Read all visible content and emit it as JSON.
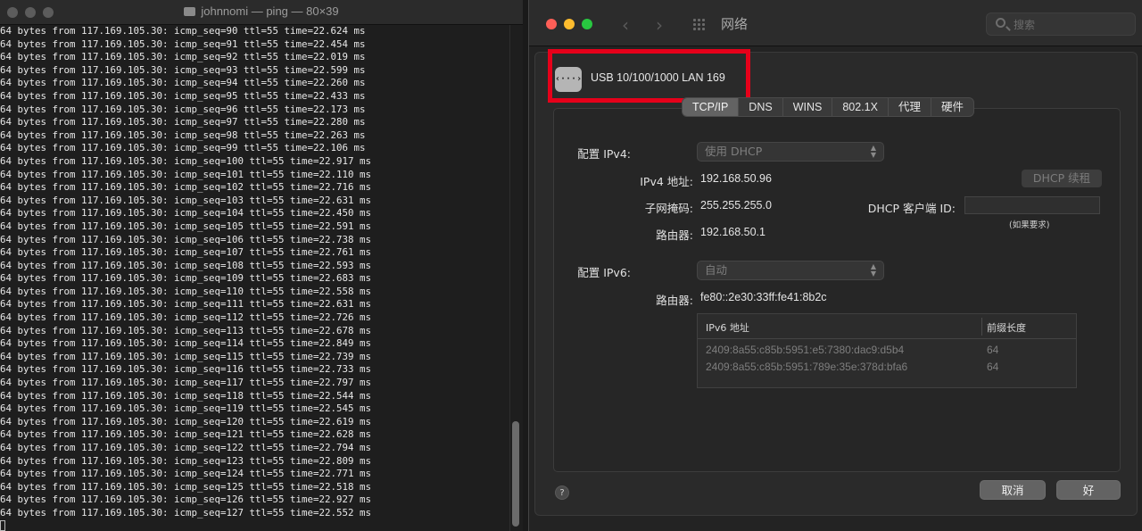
{
  "terminal": {
    "title": "johnnomi — ping — 80×39",
    "lines": [
      "64 bytes from 117.169.105.30: icmp_seq=90 ttl=55 time=22.624 ms",
      "64 bytes from 117.169.105.30: icmp_seq=91 ttl=55 time=22.454 ms",
      "64 bytes from 117.169.105.30: icmp_seq=92 ttl=55 time=22.019 ms",
      "64 bytes from 117.169.105.30: icmp_seq=93 ttl=55 time=22.599 ms",
      "64 bytes from 117.169.105.30: icmp_seq=94 ttl=55 time=22.260 ms",
      "64 bytes from 117.169.105.30: icmp_seq=95 ttl=55 time=22.433 ms",
      "64 bytes from 117.169.105.30: icmp_seq=96 ttl=55 time=22.173 ms",
      "64 bytes from 117.169.105.30: icmp_seq=97 ttl=55 time=22.280 ms",
      "64 bytes from 117.169.105.30: icmp_seq=98 ttl=55 time=22.263 ms",
      "64 bytes from 117.169.105.30: icmp_seq=99 ttl=55 time=22.106 ms",
      "64 bytes from 117.169.105.30: icmp_seq=100 ttl=55 time=22.917 ms",
      "64 bytes from 117.169.105.30: icmp_seq=101 ttl=55 time=22.110 ms",
      "64 bytes from 117.169.105.30: icmp_seq=102 ttl=55 time=22.716 ms",
      "64 bytes from 117.169.105.30: icmp_seq=103 ttl=55 time=22.631 ms",
      "64 bytes from 117.169.105.30: icmp_seq=104 ttl=55 time=22.450 ms",
      "64 bytes from 117.169.105.30: icmp_seq=105 ttl=55 time=22.591 ms",
      "64 bytes from 117.169.105.30: icmp_seq=106 ttl=55 time=22.738 ms",
      "64 bytes from 117.169.105.30: icmp_seq=107 ttl=55 time=22.761 ms",
      "64 bytes from 117.169.105.30: icmp_seq=108 ttl=55 time=22.593 ms",
      "64 bytes from 117.169.105.30: icmp_seq=109 ttl=55 time=22.683 ms",
      "64 bytes from 117.169.105.30: icmp_seq=110 ttl=55 time=22.558 ms",
      "64 bytes from 117.169.105.30: icmp_seq=111 ttl=55 time=22.631 ms",
      "64 bytes from 117.169.105.30: icmp_seq=112 ttl=55 time=22.726 ms",
      "64 bytes from 117.169.105.30: icmp_seq=113 ttl=55 time=22.678 ms",
      "64 bytes from 117.169.105.30: icmp_seq=114 ttl=55 time=22.849 ms",
      "64 bytes from 117.169.105.30: icmp_seq=115 ttl=55 time=22.739 ms",
      "64 bytes from 117.169.105.30: icmp_seq=116 ttl=55 time=22.733 ms",
      "64 bytes from 117.169.105.30: icmp_seq=117 ttl=55 time=22.797 ms",
      "64 bytes from 117.169.105.30: icmp_seq=118 ttl=55 time=22.544 ms",
      "64 bytes from 117.169.105.30: icmp_seq=119 ttl=55 time=22.545 ms",
      "64 bytes from 117.169.105.30: icmp_seq=120 ttl=55 time=22.619 ms",
      "64 bytes from 117.169.105.30: icmp_seq=121 ttl=55 time=22.628 ms",
      "64 bytes from 117.169.105.30: icmp_seq=122 ttl=55 time=22.794 ms",
      "64 bytes from 117.169.105.30: icmp_seq=123 ttl=55 time=22.809 ms",
      "64 bytes from 117.169.105.30: icmp_seq=124 ttl=55 time=22.771 ms",
      "64 bytes from 117.169.105.30: icmp_seq=125 ttl=55 time=22.518 ms",
      "64 bytes from 117.169.105.30: icmp_seq=126 ttl=55 time=22.927 ms",
      "64 bytes from 117.169.105.30: icmp_seq=127 ttl=55 time=22.552 ms"
    ]
  },
  "network": {
    "title": "网络",
    "search_placeholder": "搜索",
    "adapter_icon_text": "‹···›",
    "adapter_name": "USB 10/100/1000 LAN 169",
    "highlight_color": "#e6001a",
    "tabs": [
      {
        "label": "TCP/IP",
        "active": true
      },
      {
        "label": "DNS",
        "active": false
      },
      {
        "label": "WINS",
        "active": false
      },
      {
        "label": "802.1X",
        "active": false
      },
      {
        "label": "代理",
        "active": false
      },
      {
        "label": "硬件",
        "active": false
      }
    ],
    "configure_ipv4_label": "配置 IPv4:",
    "configure_ipv4_value": "使用 DHCP",
    "ipv4_address_label": "IPv4 地址:",
    "ipv4_address": "192.168.50.96",
    "renew_dhcp_label": "DHCP 续租",
    "subnet_mask_label": "子网掩码:",
    "subnet_mask": "255.255.255.0",
    "dhcp_client_id_label": "DHCP 客户端 ID:",
    "dhcp_client_id_hint": "(如果要求)",
    "router_label": "路由器:",
    "router": "192.168.50.1",
    "configure_ipv6_label": "配置 IPv6:",
    "configure_ipv6_value": "自动",
    "router6_label": "路由器:",
    "router6": "fe80::2e30:33ff:fe41:8b2c",
    "ipv6_table": {
      "headers": [
        "IPv6 地址",
        "前缀长度"
      ],
      "rows": [
        [
          "2409:8a55:c85b:5951:e5:7380:dac9:d5b4",
          "64"
        ],
        [
          "2409:8a55:c85b:5951:789e:35e:378d:bfa6",
          "64"
        ]
      ]
    },
    "help_label": "?",
    "cancel_label": "取消",
    "ok_label": "好"
  }
}
